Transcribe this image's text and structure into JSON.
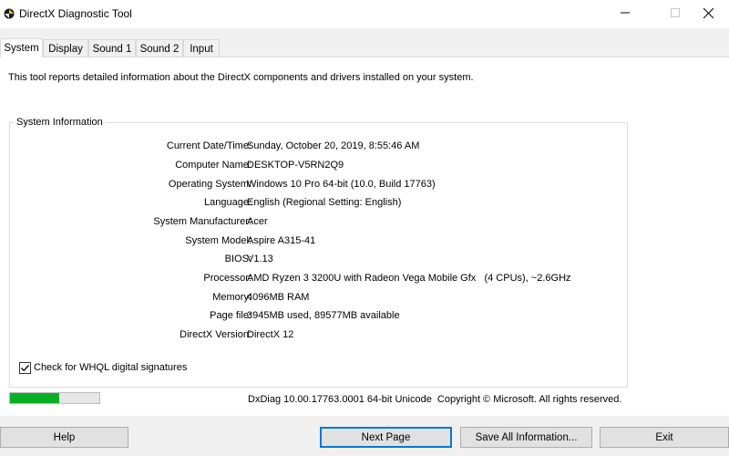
{
  "window": {
    "title": "DirectX Diagnostic Tool",
    "app_icon": "directx-icon",
    "controls": {
      "minimize": "minimize-icon",
      "maximize": "maximize-icon",
      "close": "close-icon"
    }
  },
  "tabs": [
    {
      "label": "System",
      "active": true
    },
    {
      "label": "Display",
      "active": false
    },
    {
      "label": "Sound 1",
      "active": false
    },
    {
      "label": "Sound 2",
      "active": false
    },
    {
      "label": "Input",
      "active": false
    }
  ],
  "intro_text": "This tool reports detailed information about the DirectX components and drivers installed on your system.",
  "system_info": {
    "group_title": "System Information",
    "rows": [
      {
        "label": "Current Date/Time:",
        "value": "Sunday, October 20, 2019, 8:55:46 AM"
      },
      {
        "label": "Computer Name:",
        "value": "DESKTOP-V5RN2Q9"
      },
      {
        "label": "Operating System:",
        "value": "Windows 10 Pro 64-bit (10.0, Build 17763)"
      },
      {
        "label": "Language:",
        "value": "English (Regional Setting: English)"
      },
      {
        "label": "System Manufacturer:",
        "value": "Acer"
      },
      {
        "label": "System Model:",
        "value": "Aspire A315-41"
      },
      {
        "label": "BIOS:",
        "value": "V1.13"
      },
      {
        "label": "Processor:",
        "value": "AMD Ryzen 3 3200U with Radeon Vega Mobile Gfx   (4 CPUs), ~2.6GHz"
      },
      {
        "label": "Memory:",
        "value": "4096MB RAM"
      },
      {
        "label": "Page file:",
        "value": "3945MB used, 89577MB available"
      },
      {
        "label": "DirectX Version:",
        "value": "DirectX 12"
      }
    ],
    "whql_checkbox": {
      "label": "Check for WHQL digital signatures",
      "checked": true
    }
  },
  "status": {
    "progress_fraction": 0.55,
    "progress_color": "#06b025",
    "footer_text": "DxDiag 10.00.17763.0001 64-bit Unicode  Copyright © Microsoft. All rights reserved."
  },
  "buttons": {
    "help": "Help",
    "next_page": "Next Page",
    "save_all": "Save All Information...",
    "exit": "Exit"
  }
}
